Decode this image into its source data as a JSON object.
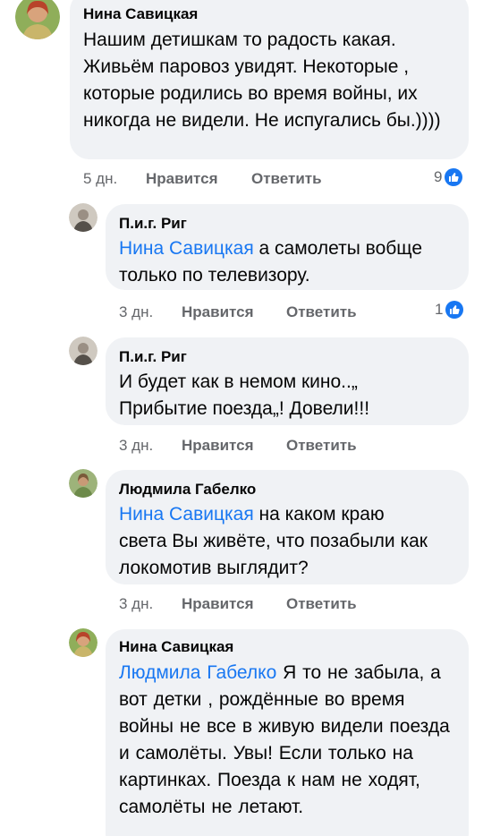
{
  "comments": [
    {
      "author": "Нина Савицкая",
      "mention": "",
      "text": "Нашим детишкам то радость какая. Живьём паровоз увидят. Некоторые , которые родились во время войны, их никогда не видели. Не испугались бы.))))",
      "time": "5 дн.",
      "like_label": "Нравится",
      "reply_label": "Ответить",
      "reactions": "9"
    },
    {
      "author": "П.и.г. Риг",
      "mention": "Нина Савицкая",
      "text": "а самолеты вобще только по телевизору.",
      "time": "3 дн.",
      "like_label": "Нравится",
      "reply_label": "Ответить",
      "reactions": "1"
    },
    {
      "author": "П.и.г. Риг",
      "mention": "",
      "text": "И будет как в немом кино..„ Прибытие поезда„! Довели!!!",
      "time": "3 дн.",
      "like_label": "Нравится",
      "reply_label": "Ответить",
      "reactions": ""
    },
    {
      "author": "Людмила Габелко",
      "mention": "Нина Савицкая",
      "text": "на каком краю света Вы живёте, что позабыли как локомотив выглядит?",
      "time": "3 дн.",
      "like_label": "Нравится",
      "reply_label": "Ответить",
      "reactions": ""
    },
    {
      "author": "Нина Савицкая",
      "mention": "Людмила Габелко",
      "text": "Я то не забыла, а вот детки , рождённые во время войны не все в живую видели поезда и самолёты. Увы! Если только на картинках. Поезда к нам не ходят, самолёты не летают.",
      "time": "",
      "like_label": "",
      "reply_label": "",
      "reactions": ""
    }
  ],
  "icons": {
    "like": "thumbs-up-icon"
  },
  "colors": {
    "bubble": "#f0f2f5",
    "mention": "#1877f2",
    "meta": "#65676b",
    "like_badge": "#1877f2"
  }
}
